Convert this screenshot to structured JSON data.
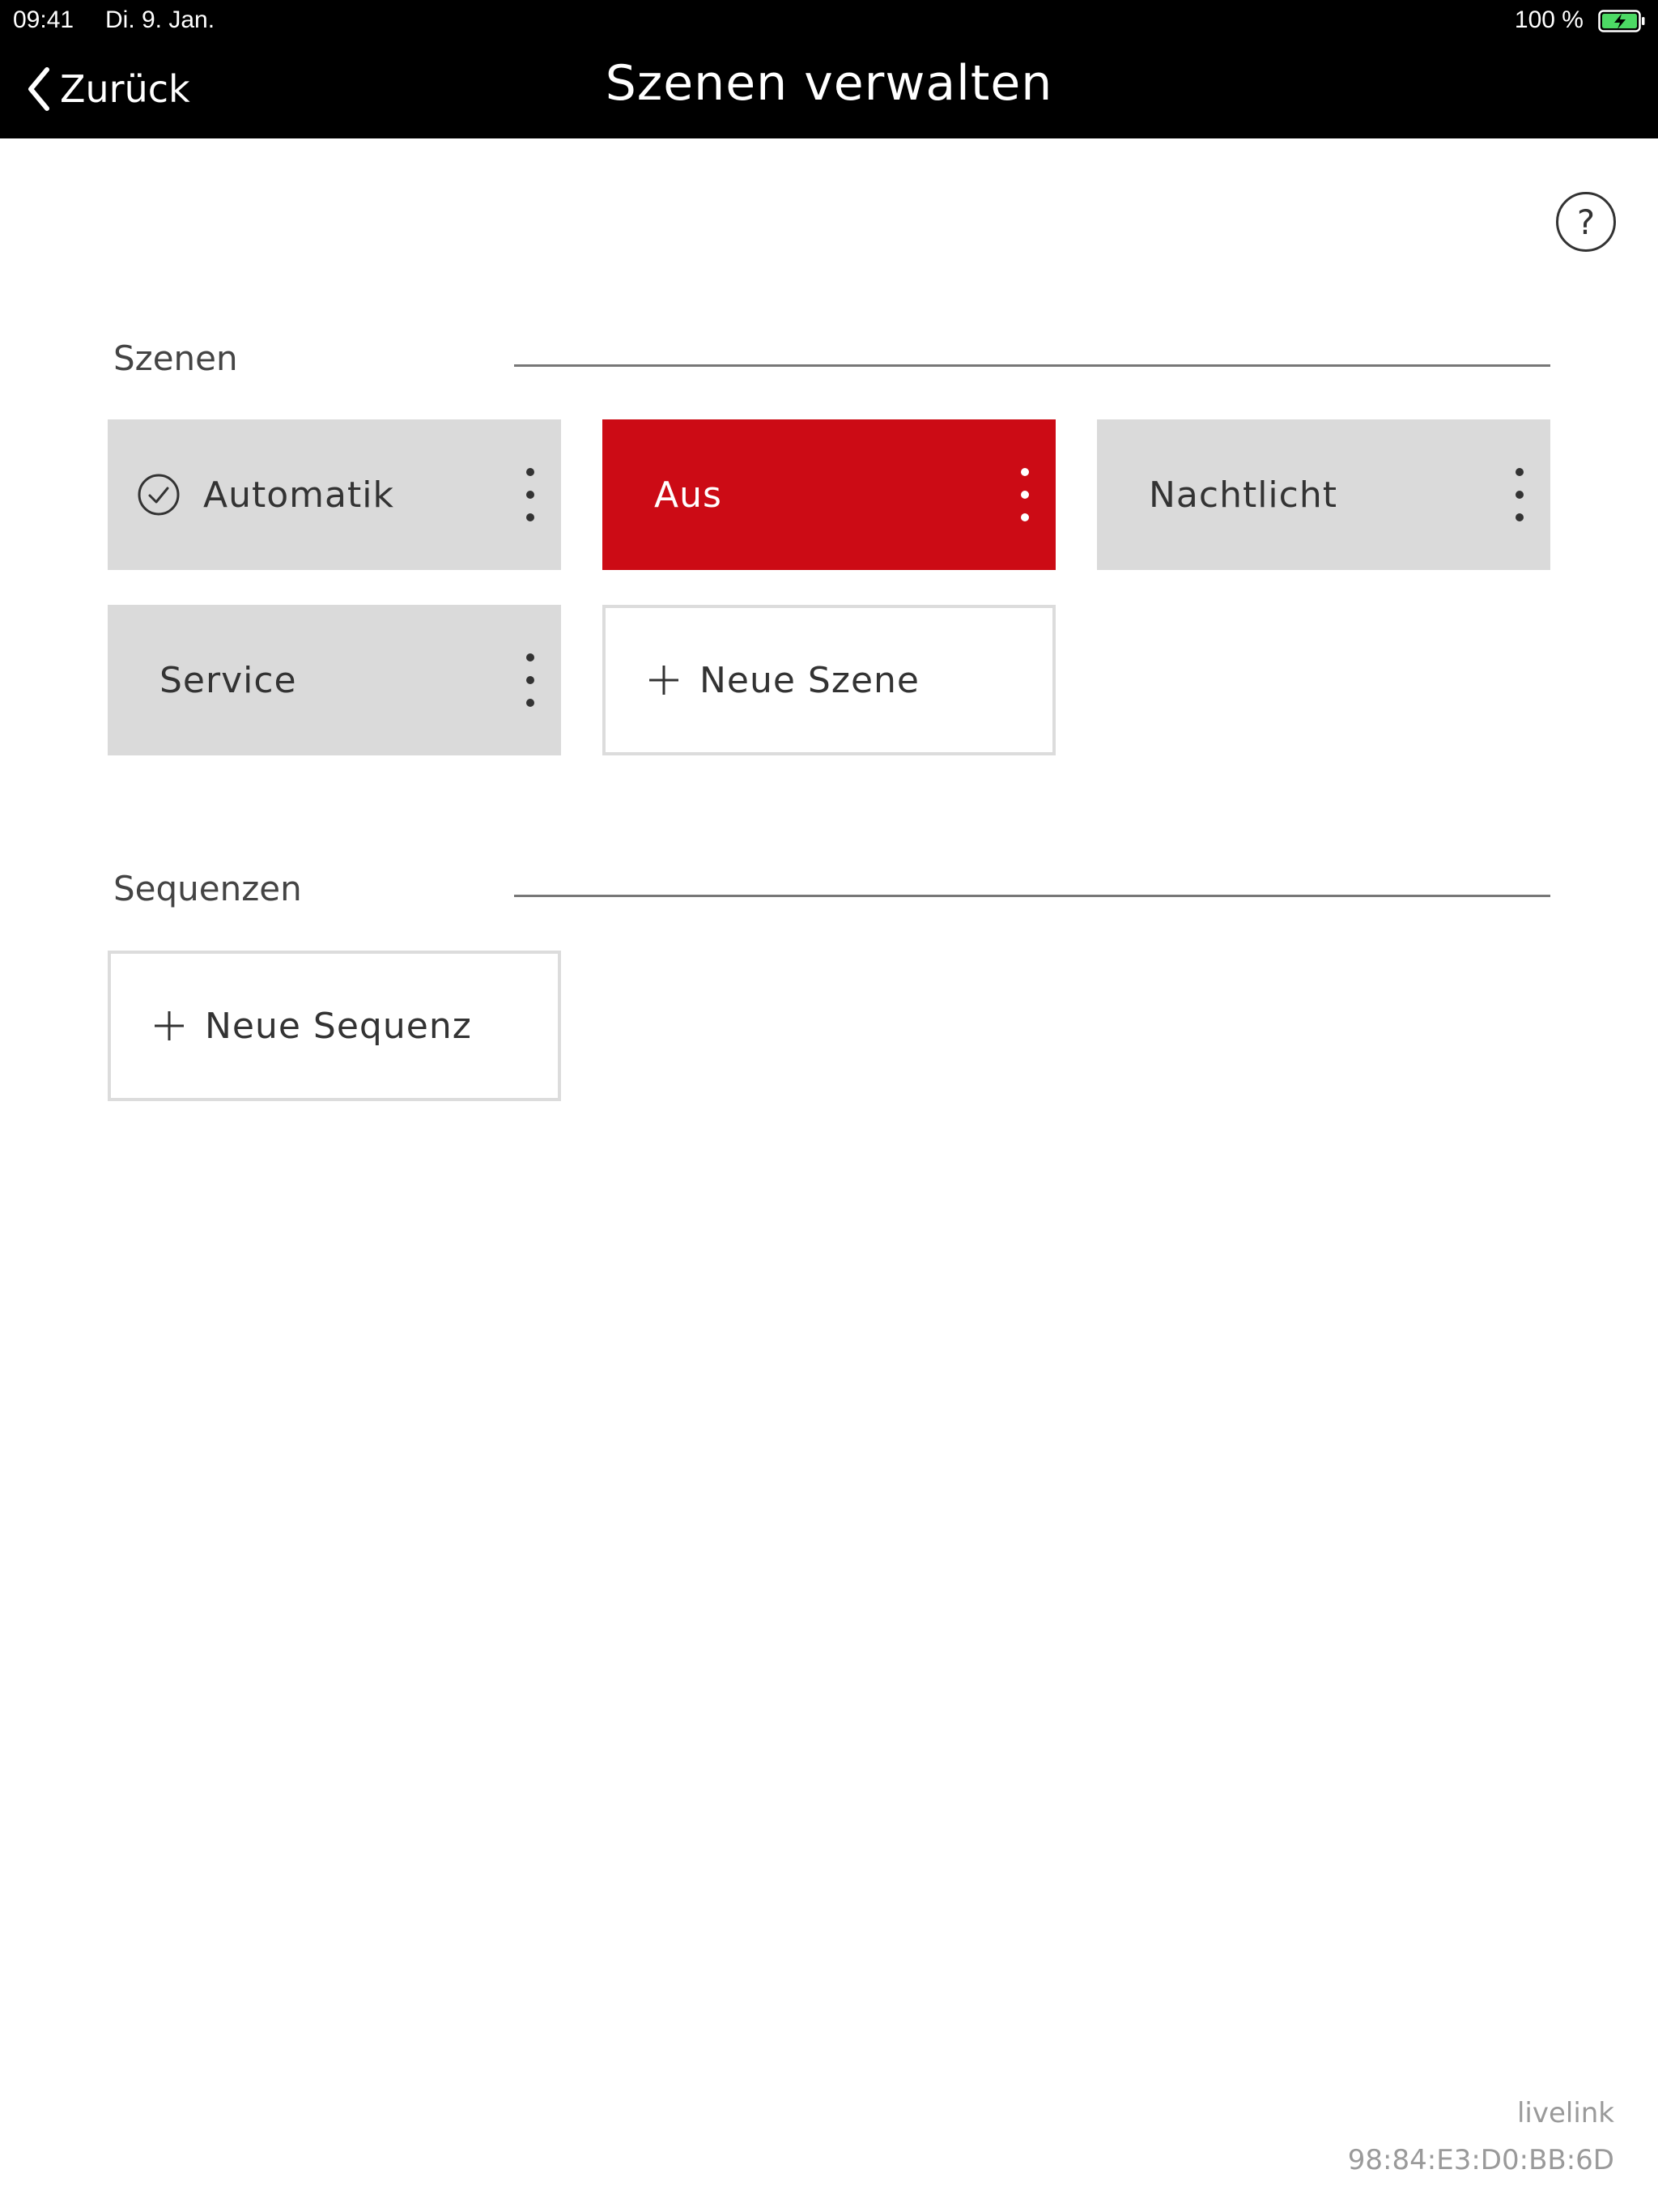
{
  "status_bar": {
    "time": "09:41",
    "date": "Di. 9. Jan.",
    "battery": "100 %"
  },
  "nav": {
    "back_label": "Zurück",
    "title": "Szenen verwalten"
  },
  "help": {
    "label": "?"
  },
  "scenes": {
    "title": "Szenen",
    "items": [
      {
        "label": "Automatik",
        "active": true
      },
      {
        "label": "Aus",
        "selected": true
      },
      {
        "label": "Nachtlicht"
      },
      {
        "label": "Service"
      }
    ],
    "add_label": "Neue Szene"
  },
  "sequences": {
    "title": "Sequenzen",
    "add_label": "Neue Sequenz"
  },
  "footer": {
    "device": "livelink",
    "mac": "98:84:E3:D0:BB:6D"
  },
  "colors": {
    "accent_red": "#cc0b15",
    "tile_gray": "#dadada",
    "battery_green": "#4cd964"
  }
}
